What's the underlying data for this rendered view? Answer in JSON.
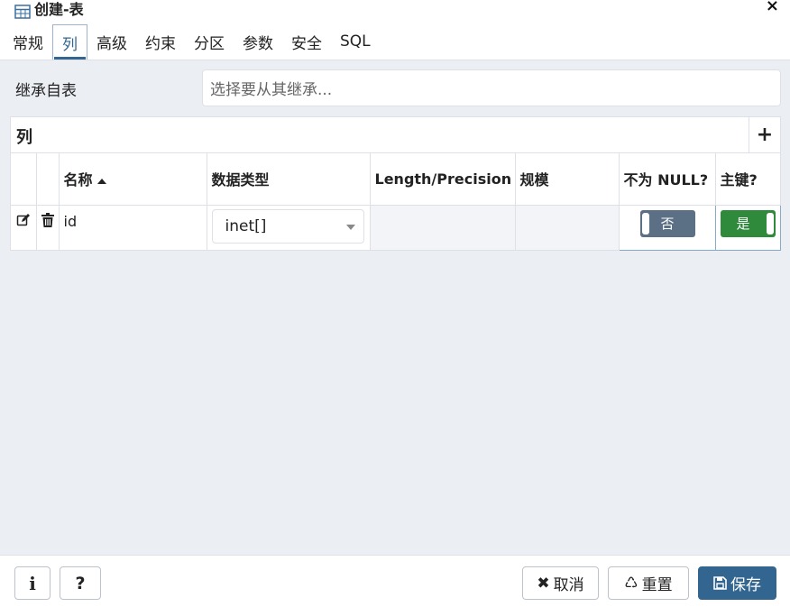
{
  "window": {
    "title": "创建-表",
    "close_icon": "×"
  },
  "tabs": [
    {
      "label": "常规",
      "active": false
    },
    {
      "label": "列",
      "active": true
    },
    {
      "label": "高级",
      "active": false
    },
    {
      "label": "约束",
      "active": false
    },
    {
      "label": "分区",
      "active": false
    },
    {
      "label": "参数",
      "active": false
    },
    {
      "label": "安全",
      "active": false
    },
    {
      "label": "SQL",
      "active": false
    }
  ],
  "inherit": {
    "label": "继承自表",
    "placeholder": "选择要从其继承..."
  },
  "columns_grid": {
    "title": "列",
    "add_label": "+",
    "headers": {
      "name": "名称",
      "data_type": "数据类型",
      "length": "Length/Precision",
      "scale": "规模",
      "not_null": "不为 NULL?",
      "primary_key": "主键?"
    },
    "rows": [
      {
        "name": "id",
        "data_type": "inet[]",
        "length": "",
        "scale": "",
        "not_null": "否",
        "primary_key": "是"
      }
    ]
  },
  "footer": {
    "info_label": "i",
    "help_label": "?",
    "cancel_label": "取消",
    "reset_label": "重置",
    "save_label": "保存"
  },
  "colors": {
    "accent": "#326690",
    "toggle_off": "#5b6f85",
    "toggle_on": "#2f8a3b",
    "background": "#ebeef3"
  }
}
